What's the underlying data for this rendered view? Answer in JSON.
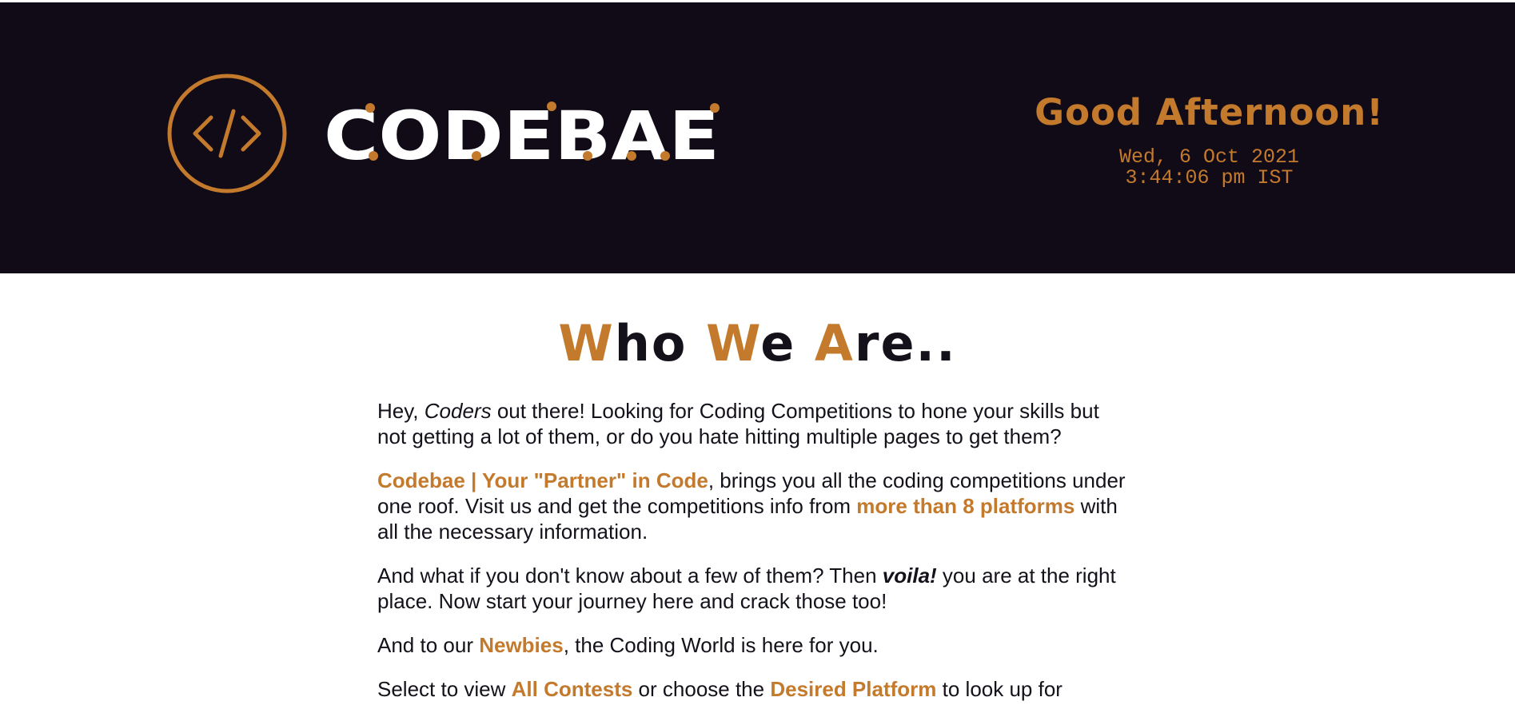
{
  "brand": {
    "name": "CODEBAE",
    "logo_symbol": "</>",
    "colors": {
      "accent": "#c47a2c",
      "header_bg": "#110b17",
      "text": "#15111a",
      "white": "#ffffff"
    }
  },
  "header": {
    "greeting": "Good Afternoon!",
    "date": "Wed, 6 Oct 2021",
    "time": "3:44:06 pm IST"
  },
  "about": {
    "title": {
      "w1_first": "W",
      "w1_rest": "ho ",
      "w2_first": "W",
      "w2_rest": "e ",
      "w3_first": "A",
      "w3_rest": "re.."
    },
    "p1": {
      "t1": "Hey, ",
      "coders": "Coders",
      "t2": " out there! Looking for Coding Competitions to hone your skills but not getting a lot of them, or do you hate hitting multiple pages to get them?"
    },
    "p2": {
      "brand_link": "Codebae | Your \"Partner\" in Code",
      "t1": ", brings you all the coding competitions under one roof. Visit us and get the competitions info from ",
      "platforms_link": "more than 8 platforms",
      "t2": " with all the necessary information."
    },
    "p3": {
      "t1": "And what if you don't know about a few of them? Then ",
      "voila": "voila!",
      "t2": " you are at the right place. Now start your journey here and crack those too!"
    },
    "p4": {
      "t1": "And to our ",
      "newbies_link": "Newbies",
      "t2": ", the Coding World is here for you."
    },
    "p5": {
      "t1": "Select to view ",
      "all_contests_link": "All Contests",
      "t2": " or choose the ",
      "desired_platform_link": "Desired Platform",
      "t3": " to look up for"
    }
  }
}
